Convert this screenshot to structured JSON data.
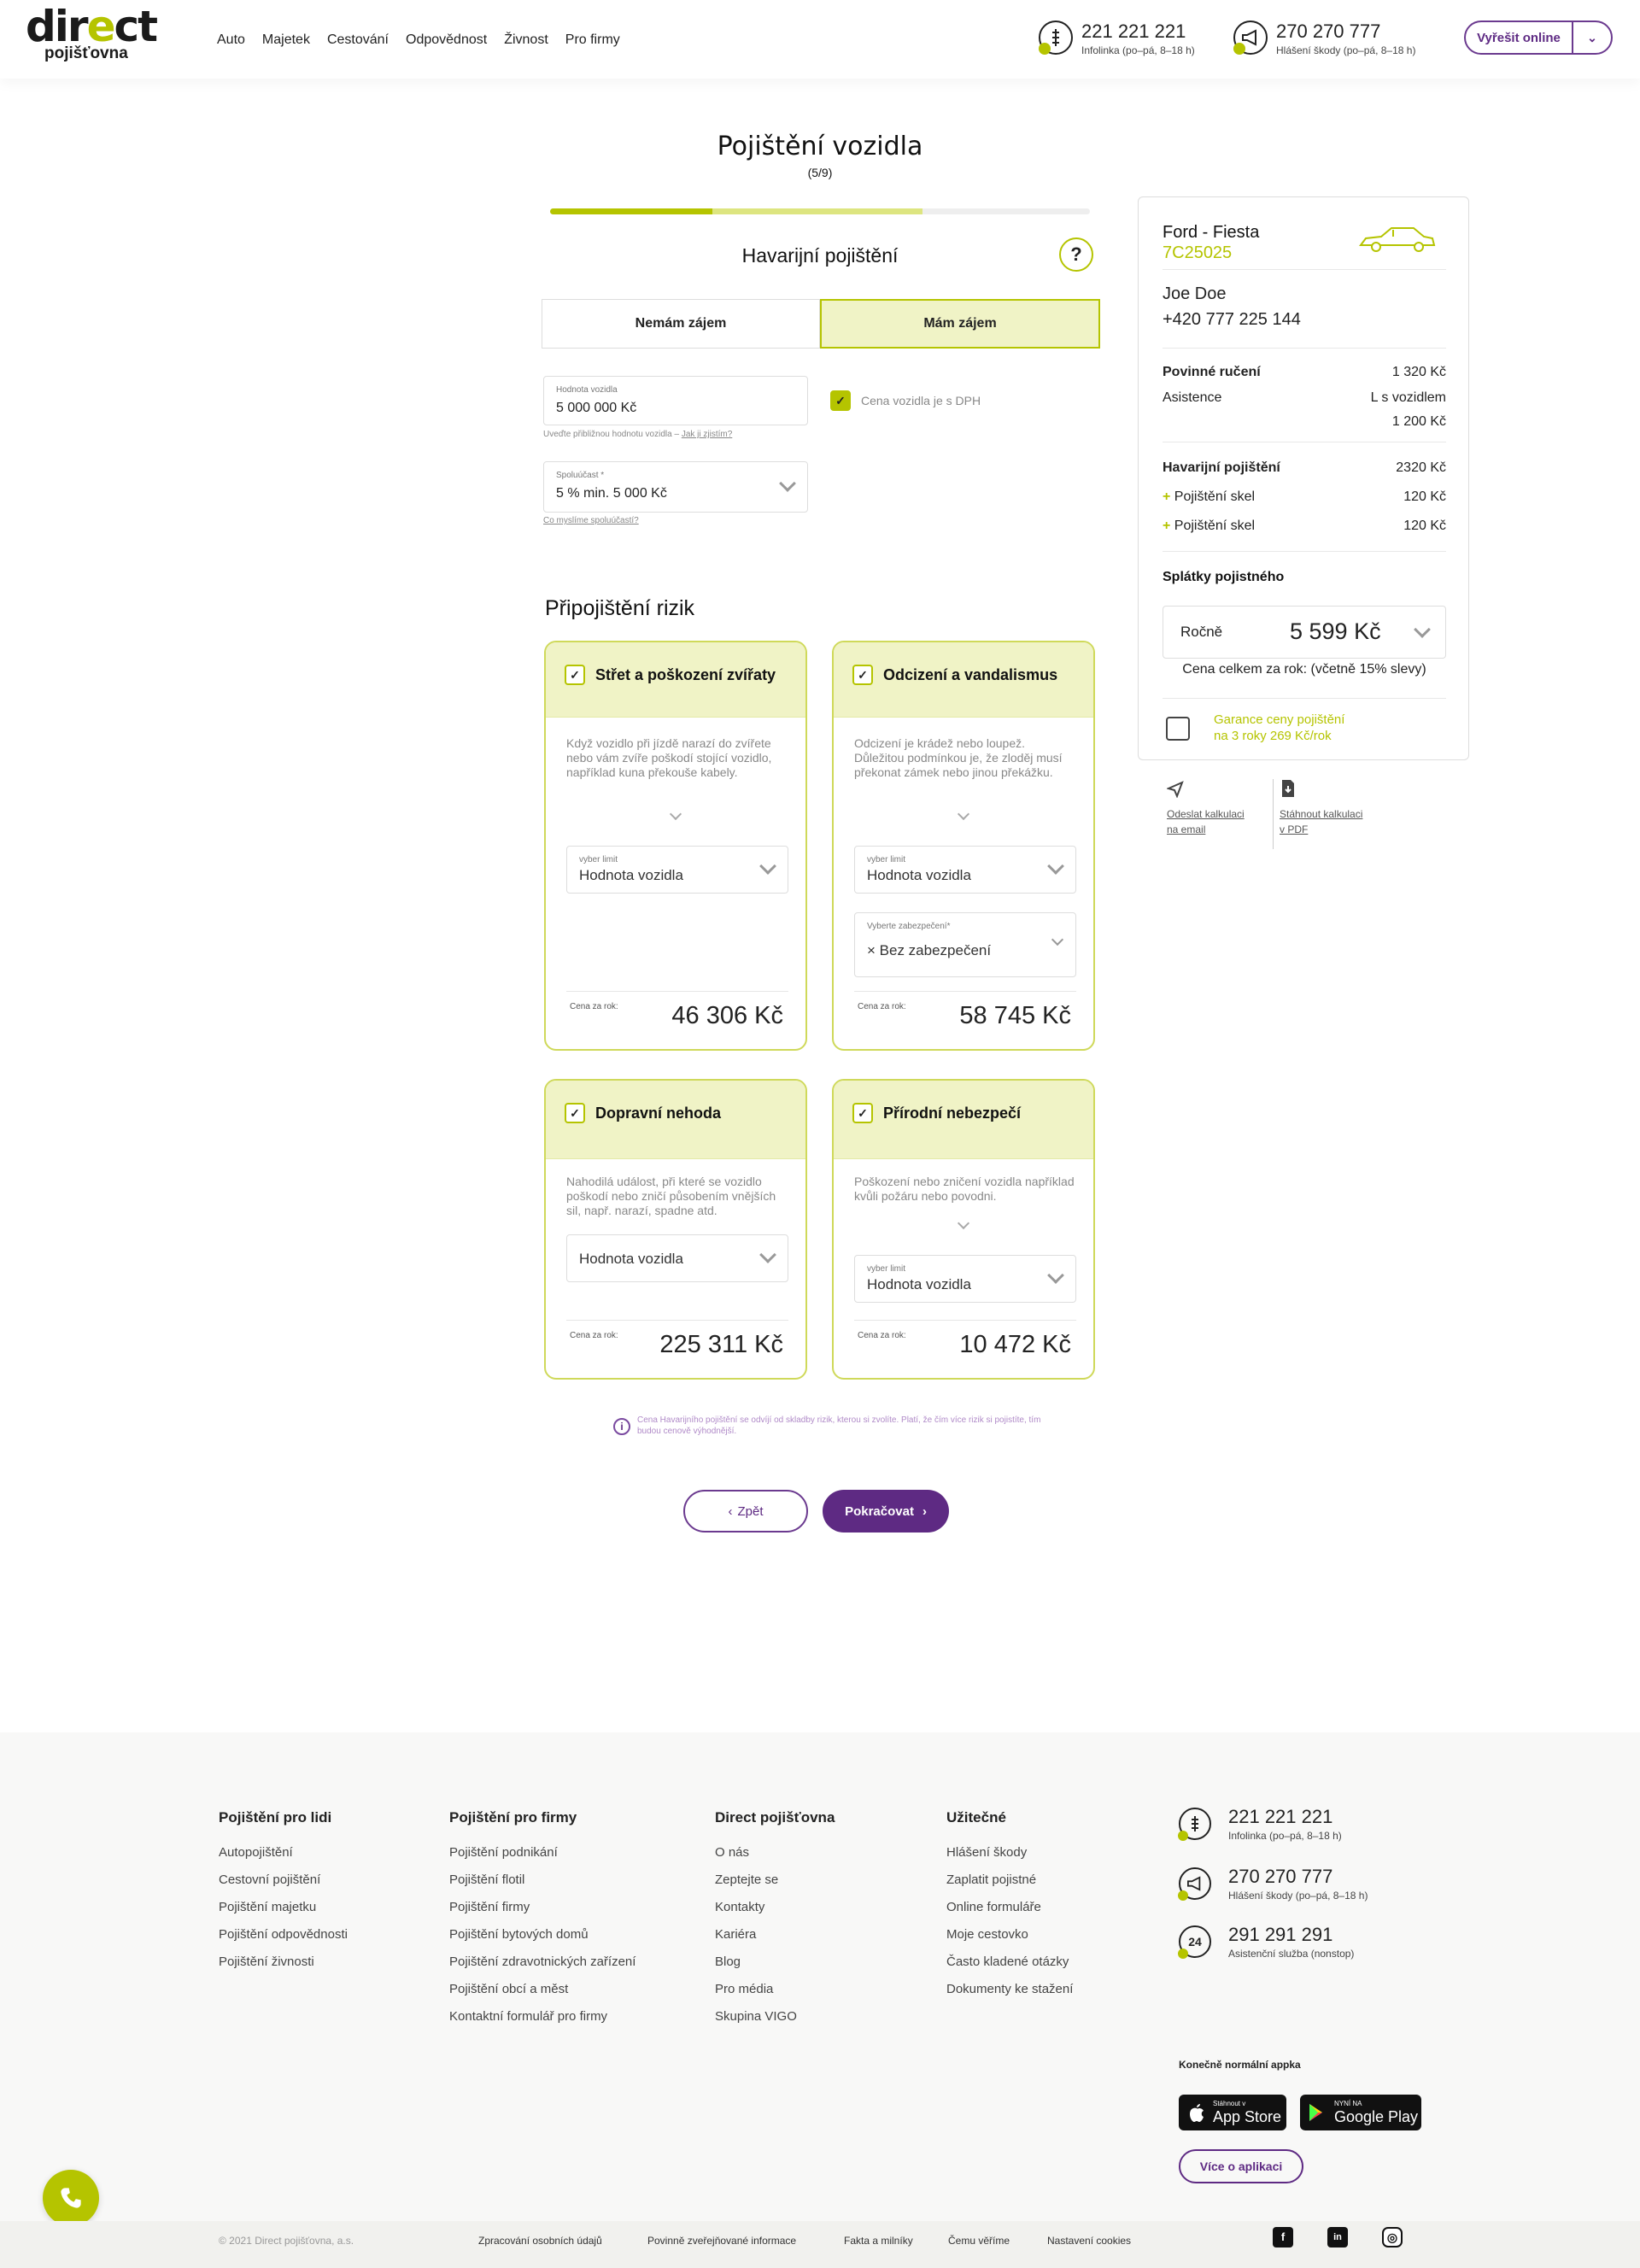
{
  "header": {
    "logo_main_a": "dir",
    "logo_main_e": "e",
    "logo_main_b": "ct",
    "logo_sub": "pojišťovna",
    "nav": [
      "Auto",
      "Majetek",
      "Cestování",
      "Odpovědnost",
      "Živnost",
      "Pro firmy"
    ],
    "phone1": {
      "number": "221 221 221",
      "label": "Infolinka (po–pá, 8–18 h)"
    },
    "phone2": {
      "number": "270 270 777",
      "label": "Hlášení škody (po–pá, 8–18 h)"
    },
    "resolve_online": "Vyřešit online"
  },
  "main": {
    "title": "Pojištění vozidla",
    "step": "(5/9)",
    "progress": {
      "done_fraction": 0.3,
      "partial_fraction": 0.69
    },
    "section_title": "Havarijní pojištění",
    "help_label": "?",
    "toggle_no": "Nemám zájem",
    "toggle_yes": "Mám zájem",
    "vehicle_value": {
      "label": "Hodnota vozidla",
      "value": "5 000 000 Kč",
      "hint": "Uveďte přibližnou hodnotu vozidla – ",
      "hint_link": "Jak ji zjistím?"
    },
    "vat_checkbox": "Cena vozidla je s DPH",
    "deductible": {
      "label": "Spoluúčast *",
      "value": "5 % min. 5 000 Kč",
      "hint_link": "Co myslíme spoluúčastí?"
    },
    "riders_title": "Připojištění rizik",
    "cards": [
      {
        "title": "Střet a poškození zvířaty",
        "desc": "Když vozidlo při jízdě narazí do zvířete nebo vám zvíře poškodí stojící vozidlo, například kuna překouše kabely.",
        "select_label": "vyber limit",
        "select_value": "Hodnota vozidla",
        "price_label": "Cena za rok:",
        "price": "46 306 Kč"
      },
      {
        "title": "Odcizení a vandalismus",
        "desc": "Odcizení je krádež nebo loupež. Důležitou podmínkou je, že zloděj musí překonat zámek nebo jinou překážku.",
        "select_label": "vyber limit",
        "select_value": "Hodnota vozidla",
        "select2_label": "Vyberte zabezpečení*",
        "select2_value": "×  Bez zabezpečení",
        "price_label": "Cena za rok:",
        "price": "58 745 Kč"
      },
      {
        "title": "Dopravní nehoda",
        "desc": "Nahodilá událost, při které se vozidlo poškodí nebo zničí působením vnějších sil, např. narazí, spadne atd.",
        "select_value": "Hodnota vozidla",
        "price_label": "Cena za rok:",
        "price": "225 311 Kč"
      },
      {
        "title": "Přírodní nebezpečí",
        "desc": "Poškození nebo zničení vozidla například kvůli požáru nebo povodni.",
        "select_label": "vyber limit",
        "select_value": "Hodnota vozidla",
        "price_label": "Cena za rok:",
        "price": "10 472 Kč"
      }
    ],
    "info_note": "Cena Havarijního pojištění se odvíjí od skladby rizik, kterou si zvolíte. Platí, že čím více rizik si pojistíte, tím budou cenově výhodnější.",
    "back_label": "Zpět",
    "next_label": "Pokračovat"
  },
  "summary": {
    "car_model": "Ford - Fiesta",
    "plate": "7C25025",
    "name": "Joe Doe",
    "phone": "+420 777 225 144",
    "povinne_label": "Povinné ručení",
    "povinne_value": "1 320 Kč",
    "asistence_label": "Asistence",
    "asistence_mid": "L  s vozidlem",
    "asistence_value": "1 200 Kč",
    "havarijni_label": "Havarijní pojištění",
    "havarijni_value": "2320 Kč",
    "plus_sign": "+",
    "skla1_label": "Pojištění skel",
    "skla1_value": "120 Kč",
    "skla2_label": "Pojištění skel",
    "skla2_value": "120 Kč",
    "installments_title": "Splátky pojistného",
    "frequency": "Ročně",
    "amount": "5 599 Kč",
    "total_note": "Cena celkem za rok: (včetně 15% slevy)",
    "guarantee": "Garance ceny pojištění\nna 3 roky 269 Kč/rok",
    "send_email": "Odeslat kalkulaci\nna email",
    "download_pdf": "Stáhnout kalkulaci\nv PDF"
  },
  "footer": {
    "col1": {
      "title": "Pojištění pro lidi",
      "links": [
        "Autopojištění",
        "Cestovní pojištění",
        "Pojištění majetku",
        "Pojištění odpovědnosti",
        "Pojištění živnosti"
      ]
    },
    "col2": {
      "title": "Pojištění pro firmy",
      "links": [
        "Pojištění podnikání",
        "Pojištění flotil",
        "Pojištění firmy",
        "Pojištění bytových domů",
        "Pojištění zdravotnických zařízení",
        "Pojištění obcí a měst",
        "Kontaktní formulář pro firmy"
      ]
    },
    "col3": {
      "title": "Direct pojišťovna",
      "links": [
        "O nás",
        "Zeptejte se",
        "Kontakty",
        "Kariéra",
        "Blog",
        "Pro média",
        "Skupina VIGO"
      ]
    },
    "col4": {
      "title": "Užitečné",
      "links": [
        "Hlášení škody",
        "Zaplatit pojistné",
        "Online formuláře",
        "Moje cestovko",
        "Často kladené otázky",
        "Dokumenty ke stažení"
      ]
    },
    "phones": [
      {
        "number": "221 221 221",
        "label": "Infolinka (po–pá, 8–18 h)"
      },
      {
        "number": "270 270 777",
        "label": "Hlášení škody (po–pá, 8–18 h)"
      },
      {
        "number": "291 291 291",
        "label": "Asistenční služba (nonstop)",
        "icon_text": "24"
      }
    ],
    "app_title": "Konečně normální appka",
    "appstore_small": "Stáhnout v",
    "appstore_big": "App Store",
    "gplay_small": "NYNÍ NA",
    "gplay_big": "Google Play",
    "about_app": "Více o aplikaci",
    "copyright": "© 2021 Direct pojišťovna, a.s.",
    "bottom_links": [
      "Zpracování osobních údajů",
      "Povinně zveřejňované informace",
      "Fakta a milníky",
      "Čemu věříme",
      "Nastavení cookies"
    ],
    "social_fb": "f",
    "social_li": "in",
    "social_ig": "◎"
  }
}
